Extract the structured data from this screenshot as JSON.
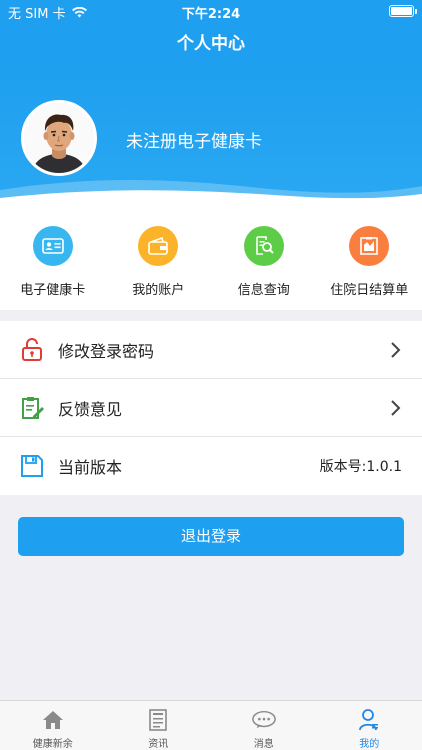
{
  "status_bar": {
    "carrier": "无 SIM 卡",
    "time": "下午2:24"
  },
  "nav": {
    "title": "个人中心"
  },
  "profile": {
    "card_status": "未注册电子健康卡"
  },
  "quick_actions": [
    {
      "label": "电子健康卡",
      "icon": "id-card-icon",
      "color": "#37b6f0"
    },
    {
      "label": "我的账户",
      "icon": "wallet-icon",
      "color": "#fbb32a"
    },
    {
      "label": "信息查询",
      "icon": "document-search-icon",
      "color": "#5dcc47"
    },
    {
      "label": "住院日结算单",
      "icon": "bill-icon",
      "color": "#fa7e3d"
    }
  ],
  "menu": [
    {
      "label": "修改登录密码",
      "icon": "lock-icon"
    },
    {
      "label": "反馈意见",
      "icon": "edit-note-icon"
    },
    {
      "label": "当前版本",
      "icon": "save-icon",
      "value": "版本号:1.0.1"
    }
  ],
  "logout_label": "退出登录",
  "tabs": [
    {
      "label": "健康新余",
      "icon": "home-icon"
    },
    {
      "label": "资讯",
      "icon": "news-icon"
    },
    {
      "label": "消息",
      "icon": "chat-icon"
    },
    {
      "label": "我的",
      "icon": "user-icon",
      "active": true
    }
  ],
  "colors": {
    "primary": "#1e9fef",
    "danger": "#e53935",
    "success": "#43a047"
  }
}
